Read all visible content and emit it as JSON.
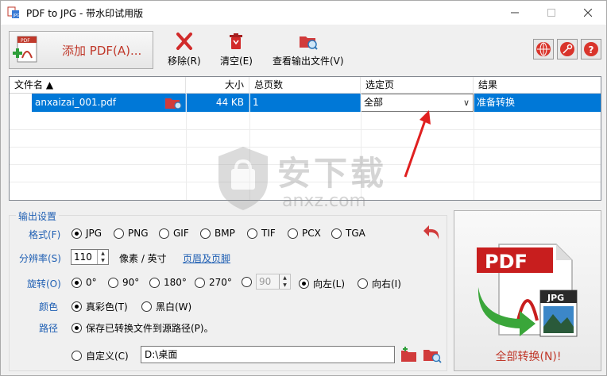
{
  "window": {
    "title": "PDF to JPG - 带水印试用版"
  },
  "toolbar": {
    "add_pdf_label": "添加 PDF(A)...",
    "remove_label": "移除(R)",
    "clear_label": "清空(E)",
    "view_output_label": "查看输出文件(V)"
  },
  "table": {
    "columns": [
      "文件名 ▲",
      "大小",
      "总页数",
      "选定页",
      "结果"
    ],
    "rows": [
      {
        "filename": "anxaizai_001.pdf",
        "size": "44 KB",
        "pages": "1",
        "selected": "全部",
        "result": "准备转换"
      }
    ]
  },
  "watermark": {
    "text": "安下载",
    "sub": "anxz.com"
  },
  "settings": {
    "legend": "输出设置",
    "format_label": "格式(F)",
    "formats": [
      "JPG",
      "PNG",
      "GIF",
      "BMP",
      "TIF",
      "PCX",
      "TGA"
    ],
    "format_selected": "JPG",
    "resolution_label": "分辨率(S)",
    "resolution_value": "110",
    "resolution_unit": "像素 / 英寸",
    "header_footer_link": "页眉及页脚",
    "rotate_label": "旋转(O)",
    "rotations": [
      "0°",
      "90°",
      "180°",
      "270°"
    ],
    "rotation_selected": "0°",
    "custom_rotation_value": "90",
    "rotate_left": "向左(L)",
    "rotate_right": "向右(I)",
    "color_label": "颜色",
    "color_options": [
      "真彩色(T)",
      "黑白(W)"
    ],
    "color_selected": "真彩色(T)",
    "path_label": "路径",
    "path_source": "保存已转换文件到源路径(P)。",
    "path_custom": "自定义(C)",
    "path_value": "D:\\桌面"
  },
  "convert": {
    "label": "全部转换(N)!",
    "badge_pdf": "PDF",
    "badge_jpg": "JPG"
  },
  "colors": {
    "accent": "#0078d7",
    "brand_red": "#c0392b",
    "label_blue": "#1f5fb3"
  }
}
